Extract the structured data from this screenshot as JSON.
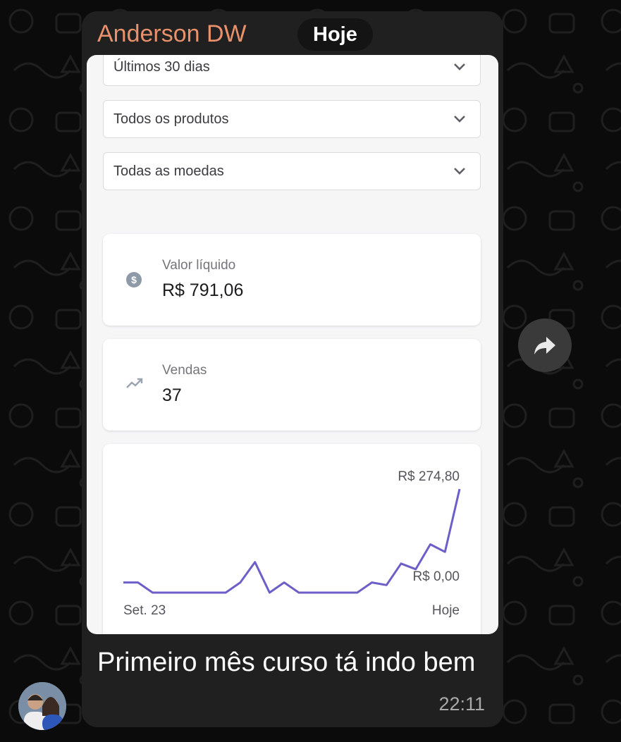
{
  "message": {
    "sender": "Anderson DW",
    "date_label": "Hoje",
    "text": "Primeiro mês curso tá indo bem",
    "time": "22:11"
  },
  "screenshot": {
    "filters": [
      {
        "label": "Últimos 30 dias"
      },
      {
        "label": "Todos os produtos"
      },
      {
        "label": "Todas as moedas"
      }
    ],
    "stats": [
      {
        "label": "Valor líquido",
        "value": "R$ 791,06",
        "icon": "dollar-circle-icon"
      },
      {
        "label": "Vendas",
        "value": "37",
        "icon": "trending-up-icon"
      }
    ]
  },
  "chart_data": {
    "type": "line",
    "title": "",
    "xlabel": "",
    "ylabel": "",
    "x_start_label": "Set. 23",
    "x_end_label": "Hoje",
    "y_max_label": "R$ 274,80",
    "y_min_label": "R$ 0,00",
    "ylim": [
      0,
      274.8
    ],
    "series": [
      {
        "color": "#6c5fc7",
        "values": [
          27,
          27,
          0,
          0,
          0,
          0,
          0,
          0,
          27,
          81,
          0,
          27,
          0,
          0,
          0,
          0,
          0,
          27,
          20,
          77,
          62,
          128,
          108,
          274.8
        ]
      }
    ]
  },
  "colors": {
    "sender": "#e8916b",
    "bubble": "#202020",
    "chart_line": "#6c5fc7"
  }
}
